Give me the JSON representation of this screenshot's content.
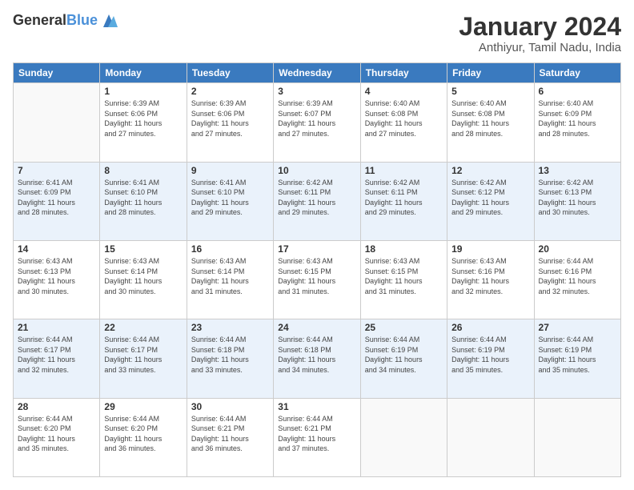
{
  "logo": {
    "line1": "General",
    "line2": "Blue"
  },
  "title": "January 2024",
  "subtitle": "Anthiyur, Tamil Nadu, India",
  "headers": [
    "Sunday",
    "Monday",
    "Tuesday",
    "Wednesday",
    "Thursday",
    "Friday",
    "Saturday"
  ],
  "weeks": [
    [
      {
        "day": "",
        "info": ""
      },
      {
        "day": "1",
        "info": "Sunrise: 6:39 AM\nSunset: 6:06 PM\nDaylight: 11 hours\nand 27 minutes."
      },
      {
        "day": "2",
        "info": "Sunrise: 6:39 AM\nSunset: 6:06 PM\nDaylight: 11 hours\nand 27 minutes."
      },
      {
        "day": "3",
        "info": "Sunrise: 6:39 AM\nSunset: 6:07 PM\nDaylight: 11 hours\nand 27 minutes."
      },
      {
        "day": "4",
        "info": "Sunrise: 6:40 AM\nSunset: 6:08 PM\nDaylight: 11 hours\nand 27 minutes."
      },
      {
        "day": "5",
        "info": "Sunrise: 6:40 AM\nSunset: 6:08 PM\nDaylight: 11 hours\nand 28 minutes."
      },
      {
        "day": "6",
        "info": "Sunrise: 6:40 AM\nSunset: 6:09 PM\nDaylight: 11 hours\nand 28 minutes."
      }
    ],
    [
      {
        "day": "7",
        "info": "Sunrise: 6:41 AM\nSunset: 6:09 PM\nDaylight: 11 hours\nand 28 minutes."
      },
      {
        "day": "8",
        "info": "Sunrise: 6:41 AM\nSunset: 6:10 PM\nDaylight: 11 hours\nand 28 minutes."
      },
      {
        "day": "9",
        "info": "Sunrise: 6:41 AM\nSunset: 6:10 PM\nDaylight: 11 hours\nand 29 minutes."
      },
      {
        "day": "10",
        "info": "Sunrise: 6:42 AM\nSunset: 6:11 PM\nDaylight: 11 hours\nand 29 minutes."
      },
      {
        "day": "11",
        "info": "Sunrise: 6:42 AM\nSunset: 6:11 PM\nDaylight: 11 hours\nand 29 minutes."
      },
      {
        "day": "12",
        "info": "Sunrise: 6:42 AM\nSunset: 6:12 PM\nDaylight: 11 hours\nand 29 minutes."
      },
      {
        "day": "13",
        "info": "Sunrise: 6:42 AM\nSunset: 6:13 PM\nDaylight: 11 hours\nand 30 minutes."
      }
    ],
    [
      {
        "day": "14",
        "info": "Sunrise: 6:43 AM\nSunset: 6:13 PM\nDaylight: 11 hours\nand 30 minutes."
      },
      {
        "day": "15",
        "info": "Sunrise: 6:43 AM\nSunset: 6:14 PM\nDaylight: 11 hours\nand 30 minutes."
      },
      {
        "day": "16",
        "info": "Sunrise: 6:43 AM\nSunset: 6:14 PM\nDaylight: 11 hours\nand 31 minutes."
      },
      {
        "day": "17",
        "info": "Sunrise: 6:43 AM\nSunset: 6:15 PM\nDaylight: 11 hours\nand 31 minutes."
      },
      {
        "day": "18",
        "info": "Sunrise: 6:43 AM\nSunset: 6:15 PM\nDaylight: 11 hours\nand 31 minutes."
      },
      {
        "day": "19",
        "info": "Sunrise: 6:43 AM\nSunset: 6:16 PM\nDaylight: 11 hours\nand 32 minutes."
      },
      {
        "day": "20",
        "info": "Sunrise: 6:44 AM\nSunset: 6:16 PM\nDaylight: 11 hours\nand 32 minutes."
      }
    ],
    [
      {
        "day": "21",
        "info": "Sunrise: 6:44 AM\nSunset: 6:17 PM\nDaylight: 11 hours\nand 32 minutes."
      },
      {
        "day": "22",
        "info": "Sunrise: 6:44 AM\nSunset: 6:17 PM\nDaylight: 11 hours\nand 33 minutes."
      },
      {
        "day": "23",
        "info": "Sunrise: 6:44 AM\nSunset: 6:18 PM\nDaylight: 11 hours\nand 33 minutes."
      },
      {
        "day": "24",
        "info": "Sunrise: 6:44 AM\nSunset: 6:18 PM\nDaylight: 11 hours\nand 34 minutes."
      },
      {
        "day": "25",
        "info": "Sunrise: 6:44 AM\nSunset: 6:19 PM\nDaylight: 11 hours\nand 34 minutes."
      },
      {
        "day": "26",
        "info": "Sunrise: 6:44 AM\nSunset: 6:19 PM\nDaylight: 11 hours\nand 35 minutes."
      },
      {
        "day": "27",
        "info": "Sunrise: 6:44 AM\nSunset: 6:19 PM\nDaylight: 11 hours\nand 35 minutes."
      }
    ],
    [
      {
        "day": "28",
        "info": "Sunrise: 6:44 AM\nSunset: 6:20 PM\nDaylight: 11 hours\nand 35 minutes."
      },
      {
        "day": "29",
        "info": "Sunrise: 6:44 AM\nSunset: 6:20 PM\nDaylight: 11 hours\nand 36 minutes."
      },
      {
        "day": "30",
        "info": "Sunrise: 6:44 AM\nSunset: 6:21 PM\nDaylight: 11 hours\nand 36 minutes."
      },
      {
        "day": "31",
        "info": "Sunrise: 6:44 AM\nSunset: 6:21 PM\nDaylight: 11 hours\nand 37 minutes."
      },
      {
        "day": "",
        "info": ""
      },
      {
        "day": "",
        "info": ""
      },
      {
        "day": "",
        "info": ""
      }
    ]
  ]
}
